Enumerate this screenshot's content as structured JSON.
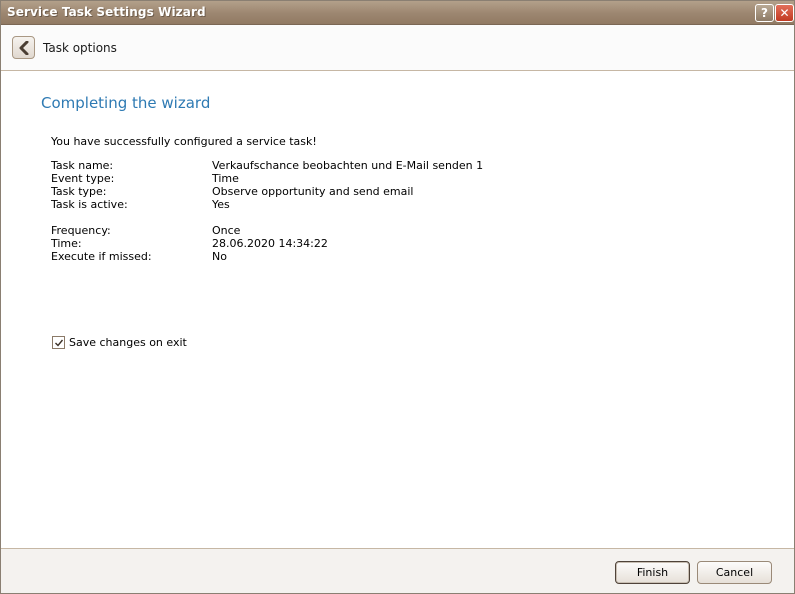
{
  "window": {
    "title": "Service Task Settings Wizard",
    "help_label": "?",
    "close_label": "✕"
  },
  "header": {
    "label": "Task options"
  },
  "main": {
    "heading": "Completing the wizard",
    "success_message": "You have successfully configured a service task!",
    "details": [
      {
        "label": "Task name:",
        "value": "Verkaufschance beobachten und E-Mail senden 1"
      },
      {
        "label": "Event type:",
        "value": "Time"
      },
      {
        "label": "Task type:",
        "value": "Observe opportunity and send email"
      },
      {
        "label": "Task is active:",
        "value": "Yes"
      },
      {
        "label": "Frequency:",
        "value": "Once"
      },
      {
        "label": "Time:",
        "value": "28.06.2020 14:34:22"
      },
      {
        "label": "Execute if missed:",
        "value": "No"
      }
    ],
    "save_changes": {
      "label": "Save changes on exit",
      "checked": true
    }
  },
  "footer": {
    "finish_label": "Finish",
    "cancel_label": "Cancel"
  },
  "colors": {
    "titlebar": "#9c8670",
    "heading": "#2e7ab3",
    "close": "#c23a22"
  }
}
